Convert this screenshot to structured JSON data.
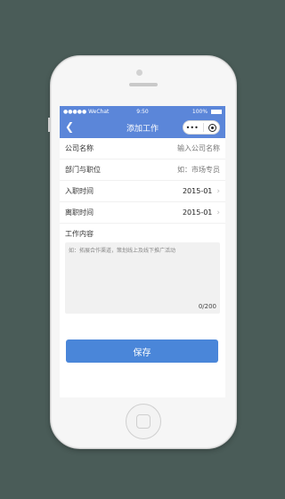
{
  "status_bar": {
    "signal": "●●●●● WeChat",
    "wifi_icon": "wifi-icon",
    "time": "9:50",
    "battery": "100%"
  },
  "navbar": {
    "back_icon": "back-chevron-icon",
    "title": "添加工作",
    "capsule_dots": "•••",
    "capsule_target_icon": "target-icon"
  },
  "form": {
    "rows": [
      {
        "label": "公司名称",
        "value": "输入公司名称",
        "has_chevron": false
      },
      {
        "label": "部门与职位",
        "value": "如：市场专员",
        "has_chevron": false
      },
      {
        "label": "入职时间",
        "value": "2015-01",
        "has_chevron": true
      },
      {
        "label": "离职时间",
        "value": "2015-01",
        "has_chevron": true
      }
    ],
    "content_label": "工作内容",
    "content_placeholder": "如：拓展合作渠道，策划线上及线下推广活动",
    "char_count": "0/200"
  },
  "save_button": "保存",
  "colors": {
    "navbar_bg": "#5b86d9",
    "button_bg": "#4a86d9",
    "page_bg": "#4a5c58"
  }
}
